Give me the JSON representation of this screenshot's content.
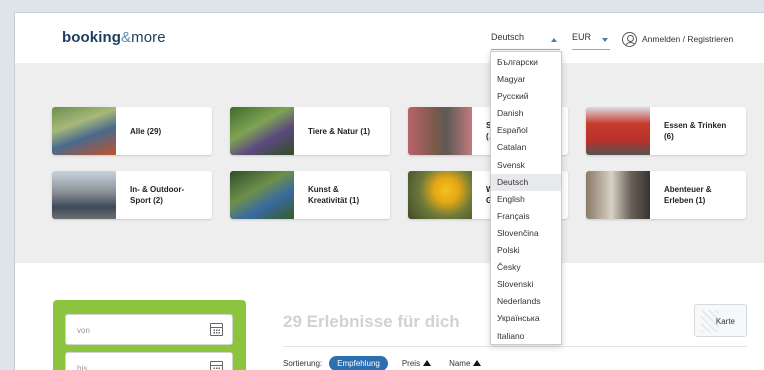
{
  "header": {
    "logo": {
      "part1": "booking",
      "part2": "&",
      "part3": "more"
    },
    "language": "Deutsch",
    "currency": "EUR",
    "login_label": "Anmelden / Registrieren"
  },
  "categories": [
    {
      "label": "Alle (29)"
    },
    {
      "label": "Tiere & Natur (1)"
    },
    {
      "label": "S…\n(…"
    },
    {
      "label": "Essen & Trinken\n(6)"
    },
    {
      "label": "In- & Outdoor-\nSport (2)"
    },
    {
      "label": "Kunst &\nKreativität (1)"
    },
    {
      "label": "W…\nG…"
    },
    {
      "label": "Abenteuer &\nErleben (1)"
    }
  ],
  "language_dropdown": {
    "options": [
      "Български",
      "Magyar",
      "Русский",
      "Danish",
      "Español",
      "Catalan",
      "Svensk",
      "Deutsch",
      "English",
      "Français",
      "Slovenčina",
      "Polski",
      "Česky",
      "Slovenski",
      "Nederlands",
      "Українська",
      "Italiano"
    ],
    "selected": "Deutsch"
  },
  "filter": {
    "from_placeholder": "von",
    "to_placeholder": "bis"
  },
  "results": {
    "title": "29 Erlebnisse für dich",
    "map_label": "Karte",
    "sort_label": "Sortierung:",
    "sort_active": "Empfehlung",
    "sort_price": "Preis",
    "sort_name": "Name"
  },
  "colors": {
    "accent": "#2c6fb0",
    "filter_green": "#8cc43f",
    "logo_navy": "#1f3f60"
  }
}
